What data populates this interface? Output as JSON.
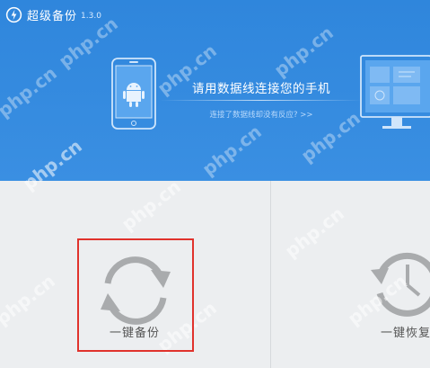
{
  "app": {
    "name": "超级备份",
    "version": "1.3.0",
    "icon": "power-icon"
  },
  "header": {
    "connect_prompt": "请用数据线连接您的手机",
    "help_link": "连接了数据线却没有反应? >>",
    "phone_illustration": "android-phone-icon",
    "computer_illustration": "computer-monitor-icon"
  },
  "actions": {
    "backup": {
      "label": "一键备份",
      "icon": "sync-arrows-icon"
    },
    "restore": {
      "label": "一键恢复",
      "icon": "clock-history-icon"
    }
  },
  "watermark": "php.cn",
  "colors": {
    "header_bg": "#2f86dc",
    "panel_bg": "#eceef0",
    "icon_gray": "#a9abad",
    "highlight": "#e0322c"
  }
}
